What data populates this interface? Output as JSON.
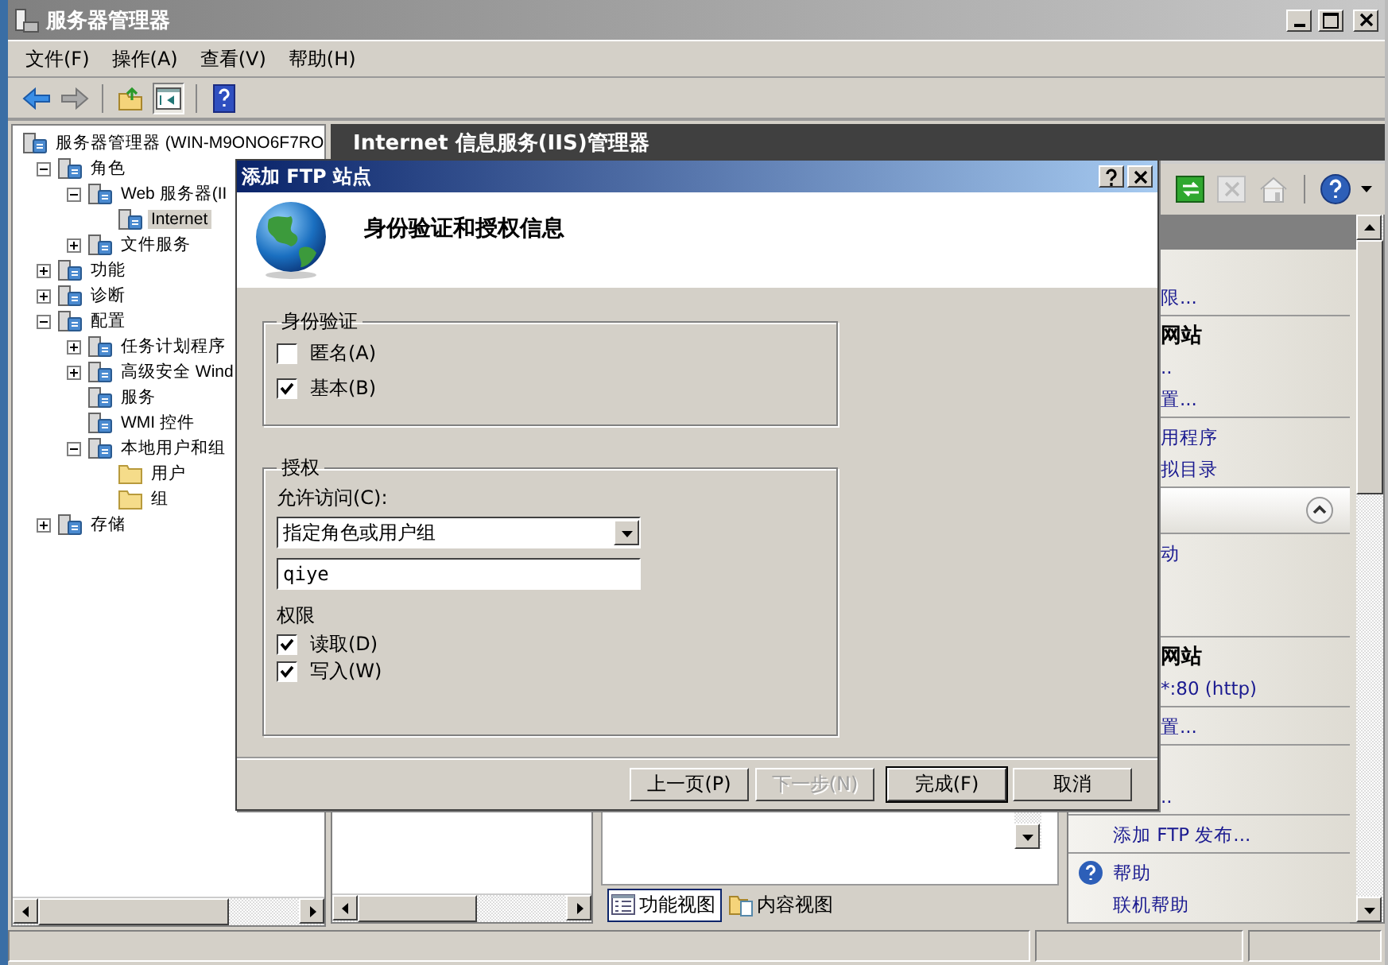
{
  "window": {
    "title": "服务器管理器"
  },
  "menu": [
    "文件(F)",
    "操作(A)",
    "查看(V)",
    "帮助(H)"
  ],
  "tree": [
    {
      "label": "服务器管理器 (WIN-M9ONO6F7RO",
      "selected": false,
      "kind": "node",
      "children": [
        {
          "label": "角色",
          "expanded": true,
          "selected": false,
          "kind": "node",
          "children": [
            {
              "label": "Web 服务器(II",
              "expanded": true,
              "selected": false,
              "kind": "node",
              "children": [
                {
                  "label": "Internet",
                  "selected": true,
                  "kind": "node"
                }
              ]
            },
            {
              "label": "文件服务",
              "expanded": false,
              "selected": false,
              "kind": "node"
            }
          ]
        },
        {
          "label": "功能",
          "expanded": false,
          "selected": false,
          "kind": "node"
        },
        {
          "label": "诊断",
          "expanded": false,
          "selected": false,
          "kind": "node"
        },
        {
          "label": "配置",
          "expanded": true,
          "selected": false,
          "kind": "node",
          "children": [
            {
              "label": "任务计划程序",
              "expanded": false,
              "selected": false,
              "kind": "node"
            },
            {
              "label": "高级安全 Wind",
              "expanded": false,
              "selected": false,
              "kind": "node"
            },
            {
              "label": "服务",
              "selected": false,
              "kind": "node"
            },
            {
              "label": "WMI 控件",
              "selected": false,
              "kind": "node"
            },
            {
              "label": "本地用户和组",
              "expanded": true,
              "selected": false,
              "kind": "node",
              "children": [
                {
                  "label": "用户",
                  "selected": false,
                  "kind": "folder"
                },
                {
                  "label": "组",
                  "selected": false,
                  "kind": "folder"
                }
              ]
            }
          ]
        },
        {
          "label": "存储",
          "expanded": false,
          "selected": false,
          "kind": "node"
        }
      ]
    }
  ],
  "iis": {
    "title": "Internet 信息服务(IIS)管理器",
    "view_tabs": [
      {
        "label": "功能视图",
        "selected": true
      },
      {
        "label": "内容视图",
        "selected": false
      }
    ],
    "actions": {
      "partly_covered": [
        {
          "kind": "list",
          "items": [
            {
              "kind": "link",
              "label": "限..."
            }
          ]
        },
        {
          "kind": "list",
          "items": [
            {
              "kind": "heading",
              "label": "网站"
            },
            {
              "kind": "link",
              "label": ".."
            },
            {
              "kind": "link",
              "label": "置..."
            }
          ]
        },
        {
          "kind": "list",
          "items": [
            {
              "kind": "link",
              "label": "用程序"
            },
            {
              "kind": "link",
              "label": "拟目录"
            }
          ]
        },
        {
          "kind": "section_header"
        },
        {
          "kind": "list",
          "items": [
            {
              "kind": "link",
              "label": "动"
            }
          ]
        },
        {
          "kind": "spacer"
        },
        {
          "kind": "list",
          "items": [
            {
              "kind": "heading",
              "label": "网站"
            },
            {
              "kind": "link",
              "label": "*:80 (http)"
            }
          ]
        },
        {
          "kind": "list",
          "items": [
            {
              "kind": "link",
              "label": "置..."
            }
          ]
        },
        {
          "kind": "list",
          "items": [
            {
              "kind": "link",
              "label": ".."
            }
          ]
        }
      ],
      "groups": [
        {
          "kind": "list",
          "items": [
            {
              "kind": "link",
              "label": "添加 FTP 发布..."
            }
          ]
        },
        {
          "kind": "list",
          "items": [
            {
              "kind": "help",
              "label": "帮助"
            },
            {
              "kind": "link",
              "label": "联机帮助"
            }
          ]
        }
      ]
    }
  },
  "dialog": {
    "title": "添加 FTP 站点",
    "heading": "身份验证和授权信息",
    "authentication": {
      "title": "身份验证",
      "options": [
        {
          "label": "匿名(A)",
          "checked": false
        },
        {
          "label": "基本(B)",
          "checked": true
        }
      ]
    },
    "authorization": {
      "title": "授权",
      "access_label": "允许访问(C):",
      "access_value": "指定角色或用户组",
      "users_value": "qiye",
      "permissions_label": "权限",
      "permissions": [
        {
          "label": "读取(D)",
          "checked": true
        },
        {
          "label": "写入(W)",
          "checked": true
        }
      ]
    },
    "buttons": [
      {
        "label": "上一页(P)",
        "disabled": false,
        "default": false
      },
      {
        "label": "下一步(N)",
        "disabled": true,
        "default": false
      },
      {
        "label": "完成(F)",
        "disabled": false,
        "default": true
      },
      {
        "label": "取消",
        "disabled": false,
        "default": false
      }
    ]
  }
}
